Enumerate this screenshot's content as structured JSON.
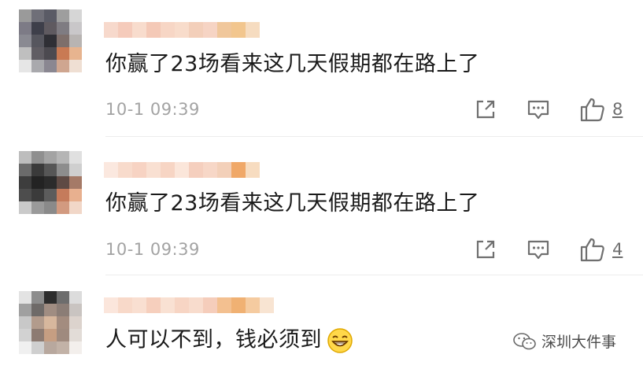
{
  "comments": [
    {
      "text": "你赢了23场看来这几天假期都在路上了",
      "time": "10-1 09:39",
      "likes": "8",
      "avatar_colors": [
        "#9a9a9a",
        "#6f6f78",
        "#5a5b66",
        "#9e9e9e",
        "#d6d6d6",
        "#7d7b86",
        "#3e3f4a",
        "#5f5a60",
        "#7f7c82",
        "#c9c7c9",
        "#8a8a92",
        "#56565e",
        "#2f2f35",
        "#7e6f6b",
        "#b8b4b2",
        "#bfbfbf",
        "#605d63",
        "#4c4a50",
        "#c97a53",
        "#e7b48f",
        "#e6e6e6",
        "#a9a9ad",
        "#8a8791",
        "#cfa690",
        "#efdfd3"
      ],
      "name_colors": [
        "#f7d9cc",
        "#f5cbbb",
        "#f8dccd",
        "#f4c9b7",
        "#f7d6c5",
        "#f8dccb",
        "#f3cfba",
        "#f6d4c4",
        "#f0c79b",
        "#f2c68e",
        "#f6dcc0"
      ]
    },
    {
      "text": "你赢了23场看来这几天假期都在路上了",
      "time": "10-1 09:39",
      "likes": "4",
      "avatar_colors": [
        "#bdbdbd",
        "#8f8f8f",
        "#a3a3a3",
        "#b5b5b5",
        "#e0e0e0",
        "#6b6b6b",
        "#3a3a3a",
        "#565656",
        "#8d8d8d",
        "#cfcfcf",
        "#3d3d3d",
        "#232323",
        "#2b2b2b",
        "#5e4a44",
        "#a57a67",
        "#4d4d4d",
        "#3b3b3b",
        "#5c5c5c",
        "#c57b5b",
        "#e8b08f",
        "#cacaca",
        "#9a9a9a",
        "#8a8a8a",
        "#d29a80",
        "#f1d7c8"
      ],
      "name_colors": [
        "#fbe8df",
        "#f8dbcc",
        "#f7d3c3",
        "#f9e0d2",
        "#f7d5c4",
        "#fbe6da",
        "#f5cfbe",
        "#f7d7c7",
        "#f3d0b9",
        "#f0a868",
        "#f7dcc0"
      ]
    },
    {
      "text": "人可以不到，钱必须到",
      "time": "",
      "likes": "",
      "avatar_colors": [
        "#e3e3e3",
        "#8c8c8c",
        "#2d2d2d",
        "#6d6d6d",
        "#dcdcdc",
        "#a0a0a0",
        "#6e6a68",
        "#a08d82",
        "#8b7d76",
        "#c9c4c1",
        "#c8c8c8",
        "#b29b8c",
        "#d7b79d",
        "#a38c7f",
        "#dcd3cd",
        "#d2d2d2",
        "#8d7b72",
        "#c69e82",
        "#9f8a7e",
        "#e2dcd7",
        "#f0f0f0",
        "#cfcfcf",
        "#b8a89e",
        "#c2b2a7",
        "#f3efec"
      ],
      "name_colors": [
        "#fbe6dc",
        "#f8d9c9",
        "#f9dfd1",
        "#f6cfbd",
        "#f9e1d3",
        "#f7d5c4",
        "#f8dccd",
        "#f5cdbb",
        "#f3c090",
        "#f0b173",
        "#f5cba0",
        "#f8e4d2"
      ]
    }
  ],
  "icons": {
    "share": "share-icon",
    "comment": "comment-icon",
    "like": "thumbs-up-icon",
    "emoji": "grin-emoji-icon"
  },
  "watermark": {
    "label": "深圳大件事"
  }
}
